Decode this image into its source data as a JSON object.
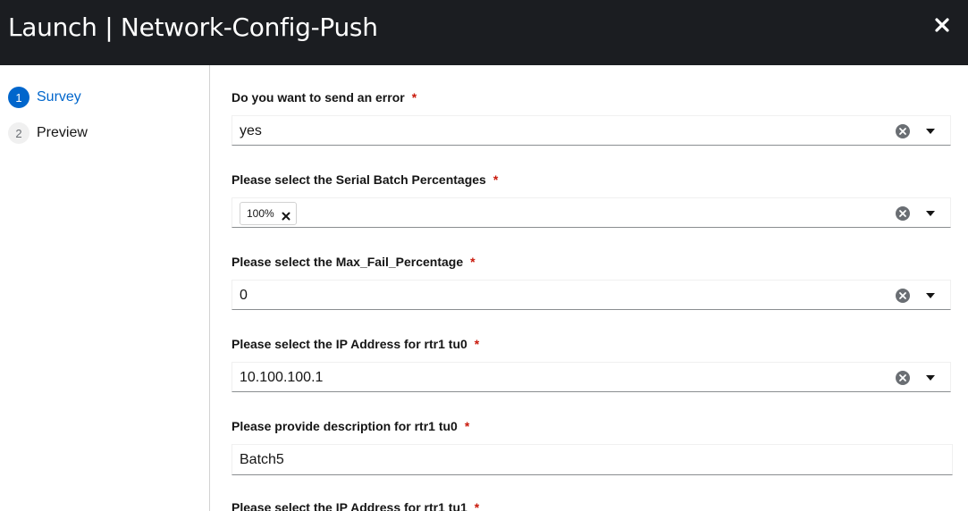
{
  "header": {
    "title": "Launch | Network-Config-Push",
    "close_icon": "close-icon"
  },
  "wizard": {
    "steps": [
      {
        "number": "1",
        "label": "Survey",
        "active": true
      },
      {
        "number": "2",
        "label": "Preview",
        "active": false
      }
    ]
  },
  "survey": {
    "required_marker": "*",
    "fields": [
      {
        "label": "Do you want to send an error",
        "type": "select",
        "value": "yes"
      },
      {
        "label": "Please select the Serial Batch Percentages",
        "type": "multiselect",
        "chips": [
          "100%"
        ]
      },
      {
        "label": "Please select the Max_Fail_Percentage",
        "type": "select",
        "value": "0"
      },
      {
        "label": "Please select the IP Address for rtr1 tu0",
        "type": "select",
        "value": "10.100.100.1"
      },
      {
        "label": "Please provide description for rtr1 tu0",
        "type": "text",
        "value": "Batch5"
      },
      {
        "label": "Please select the IP Address for rtr1 tu1",
        "type": "select",
        "value": ""
      }
    ]
  },
  "colors": {
    "header_bg": "#1b1d21",
    "accent": "#0066cc",
    "required": "#c9190b"
  }
}
